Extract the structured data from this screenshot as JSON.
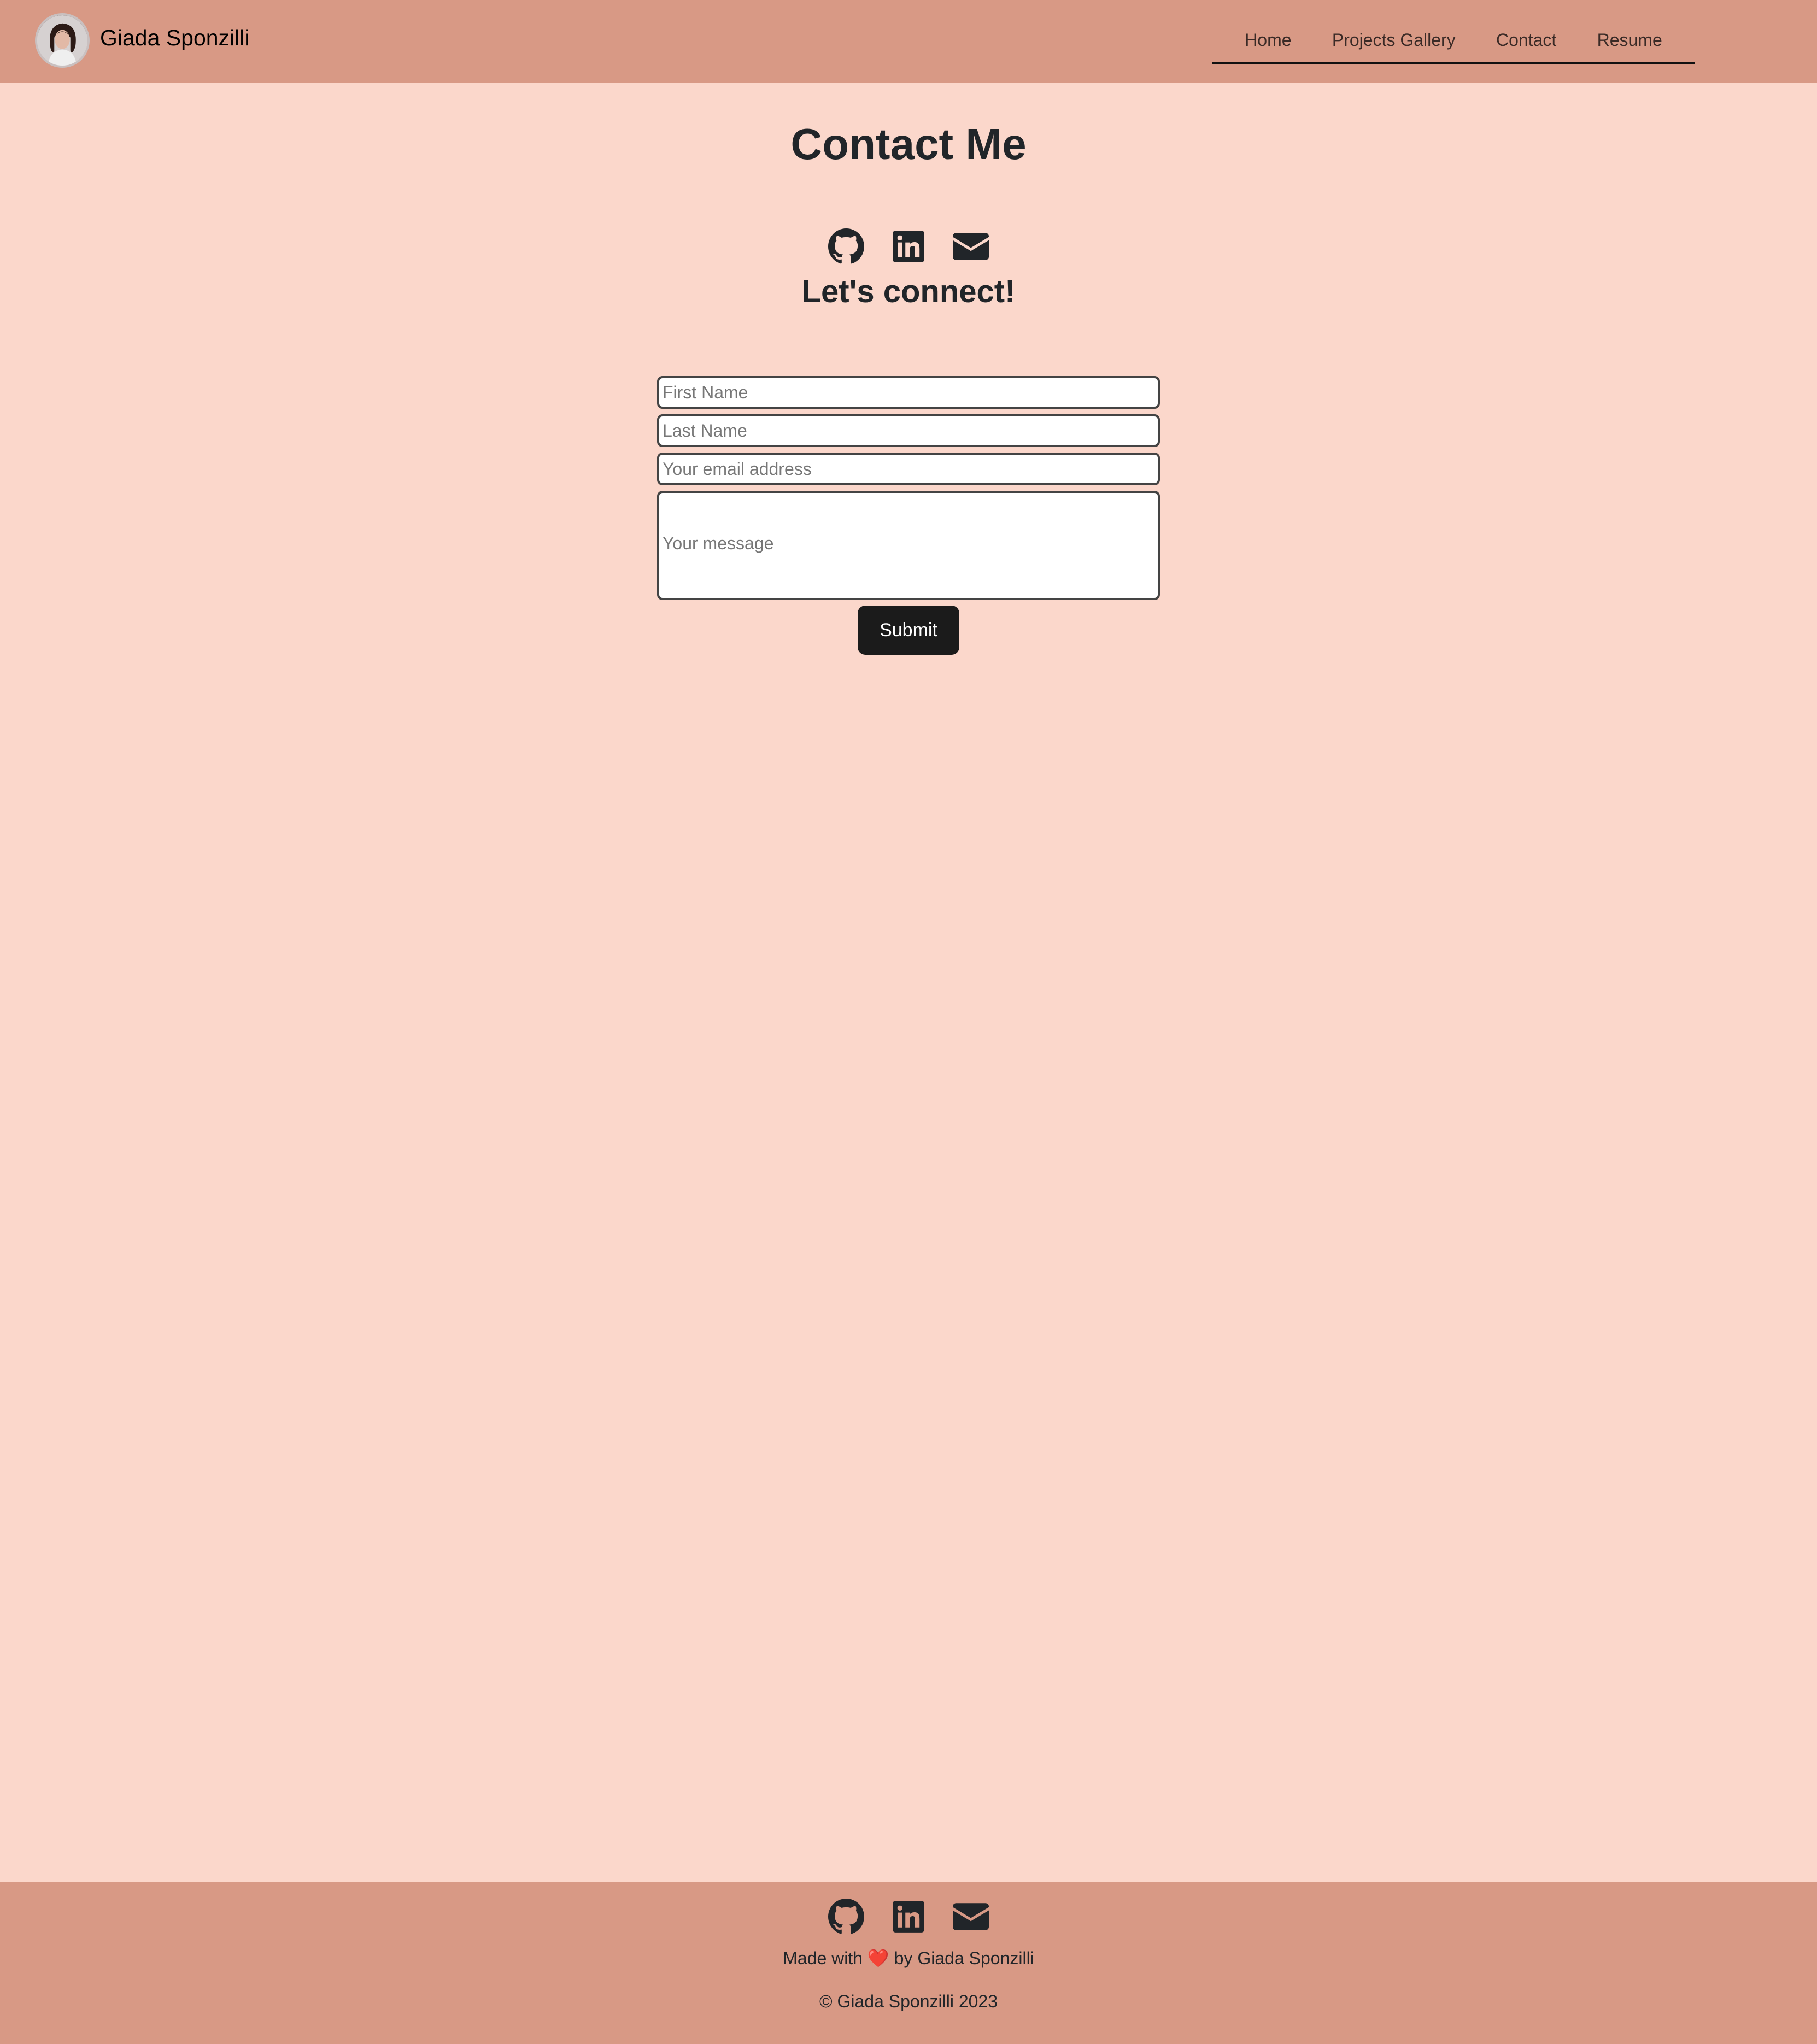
{
  "header": {
    "brand_name": "Giada Sponzilli",
    "avatar_icon": "profile-photo",
    "nav": [
      {
        "label": "Home"
      },
      {
        "label": "Projects Gallery"
      },
      {
        "label": "Contact"
      },
      {
        "label": "Resume"
      }
    ]
  },
  "main": {
    "title": "Contact Me",
    "subtitle": "Let's connect!",
    "social_icons": [
      "github-icon",
      "linkedin-icon",
      "envelope-icon"
    ],
    "form": {
      "first_name_placeholder": "First Name",
      "last_name_placeholder": "Last Name",
      "email_placeholder": "Your email address",
      "message_placeholder": "Your message",
      "submit_label": "Submit"
    }
  },
  "footer": {
    "made_prefix": "Made with",
    "heart": "❤️",
    "made_suffix": "by Giada Sponzilli",
    "copyright": "© Giada Sponzilli 2023"
  },
  "colors": {
    "page_background": "#fbd7cb",
    "header_footer_background": "#d89985",
    "button_background": "#1b1b1b",
    "text": "#212529"
  }
}
